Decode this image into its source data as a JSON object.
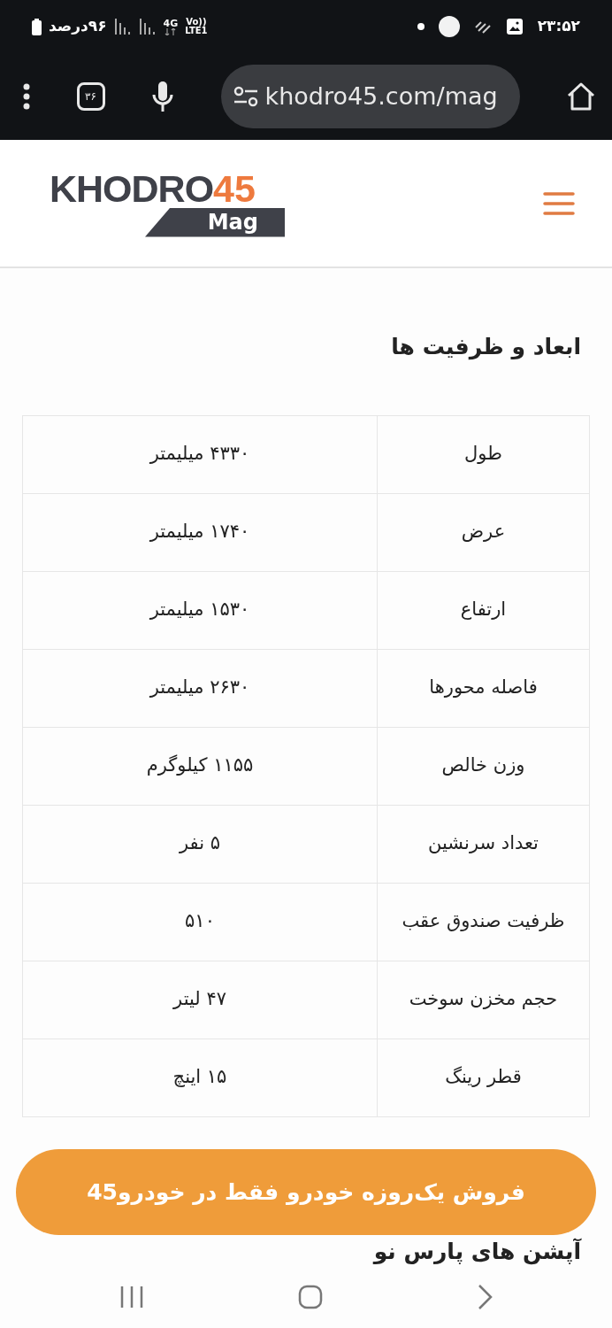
{
  "status_bar": {
    "time": "۲۳:۵۲",
    "battery": "۹۶درصد",
    "network": "4G",
    "volte": "Vo))",
    "lte": "LTE1"
  },
  "browser": {
    "tab_count": "۳۶",
    "url": "khodro45.com/mag"
  },
  "header": {
    "logo_main": "KHODRO",
    "logo_number": "45",
    "logo_sub": "Mag"
  },
  "section": {
    "title": "ابعاد و ظرفیت ها"
  },
  "table": {
    "rows": [
      {
        "label": "طول",
        "value": "۴۳۳۰ میلیمتر"
      },
      {
        "label": "عرض",
        "value": "۱۷۴۰ میلیمتر"
      },
      {
        "label": "ارتفاع",
        "value": "۱۵۳۰ میلیمتر"
      },
      {
        "label": "فاصله محورها",
        "value": "۲۶۳۰ میلیمتر"
      },
      {
        "label": "وزن خالص",
        "value": "۱۱۵۵ کیلوگرم"
      },
      {
        "label": "تعداد سرنشین",
        "value": "۵ نفر"
      },
      {
        "label": "ظرفیت صندوق عقب",
        "value": "۵۱۰"
      },
      {
        "label": "حجم مخزن سوخت",
        "value": "۴۷ لیتر"
      },
      {
        "label": "قطر رینگ",
        "value": "۱۵ اینچ"
      }
    ]
  },
  "next_section": {
    "title": "آپشن های پارس نو"
  },
  "banner": {
    "text": "فروش یک‌روزه خودرو فقط در خودرو45"
  }
}
